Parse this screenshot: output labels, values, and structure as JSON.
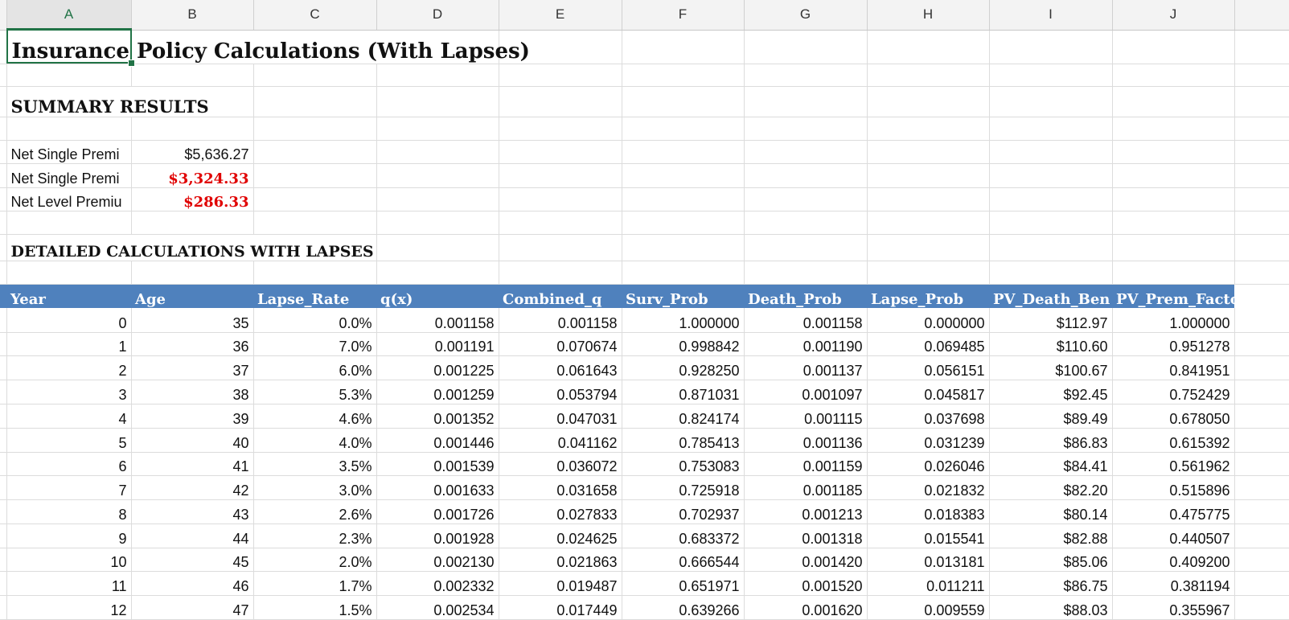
{
  "columns": [
    "A",
    "B",
    "C",
    "D",
    "E",
    "F",
    "G",
    "H",
    "I",
    "J"
  ],
  "selected_column": "A",
  "title": "Insurance Policy Calculations (With Lapses)",
  "summary": {
    "heading": "SUMMARY RESULTS",
    "rows": [
      {
        "label": "Net Single Premi",
        "value": "$5,636.27",
        "highlight": false
      },
      {
        "label": "Net Single Premi",
        "value": "$3,324.33",
        "highlight": true
      },
      {
        "label": "Net Level Premiu",
        "value": "$286.33",
        "highlight": true
      }
    ]
  },
  "details": {
    "heading": "DETAILED CALCULATIONS WITH LAPSES",
    "headers": [
      "Year",
      "Age",
      "Lapse_Rate",
      "q(x)",
      "Combined_q",
      "Surv_Prob",
      "Death_Prob",
      "Lapse_Prob",
      "PV_Death_Ben",
      "PV_Prem_Facto"
    ],
    "rows": [
      [
        "0",
        "35",
        "0.0%",
        "0.001158",
        "0.001158",
        "1.000000",
        "0.001158",
        "0.000000",
        "$112.97",
        "1.000000"
      ],
      [
        "1",
        "36",
        "7.0%",
        "0.001191",
        "0.070674",
        "0.998842",
        "0.001190",
        "0.069485",
        "$110.60",
        "0.951278"
      ],
      [
        "2",
        "37",
        "6.0%",
        "0.001225",
        "0.061643",
        "0.928250",
        "0.001137",
        "0.056151",
        "$100.67",
        "0.841951"
      ],
      [
        "3",
        "38",
        "5.3%",
        "0.001259",
        "0.053794",
        "0.871031",
        "0.001097",
        "0.045817",
        "$92.45",
        "0.752429"
      ],
      [
        "4",
        "39",
        "4.6%",
        "0.001352",
        "0.047031",
        "0.824174",
        "0.001115",
        "0.037698",
        "$89.49",
        "0.678050"
      ],
      [
        "5",
        "40",
        "4.0%",
        "0.001446",
        "0.041162",
        "0.785413",
        "0.001136",
        "0.031239",
        "$86.83",
        "0.615392"
      ],
      [
        "6",
        "41",
        "3.5%",
        "0.001539",
        "0.036072",
        "0.753083",
        "0.001159",
        "0.026046",
        "$84.41",
        "0.561962"
      ],
      [
        "7",
        "42",
        "3.0%",
        "0.001633",
        "0.031658",
        "0.725918",
        "0.001185",
        "0.021832",
        "$82.20",
        "0.515896"
      ],
      [
        "8",
        "43",
        "2.6%",
        "0.001726",
        "0.027833",
        "0.702937",
        "0.001213",
        "0.018383",
        "$80.14",
        "0.475775"
      ],
      [
        "9",
        "44",
        "2.3%",
        "0.001928",
        "0.024625",
        "0.683372",
        "0.001318",
        "0.015541",
        "$82.88",
        "0.440507"
      ],
      [
        "10",
        "45",
        "2.0%",
        "0.002130",
        "0.021863",
        "0.666544",
        "0.001420",
        "0.013181",
        "$85.06",
        "0.409200"
      ],
      [
        "11",
        "46",
        "1.7%",
        "0.002332",
        "0.019487",
        "0.651971",
        "0.001520",
        "0.011211",
        "$86.75",
        "0.381194"
      ],
      [
        "12",
        "47",
        "1.5%",
        "0.002534",
        "0.017449",
        "0.639266",
        "0.001620",
        "0.009559",
        "$88.03",
        "0.355967"
      ]
    ]
  },
  "colors": {
    "header_fill": "#4f81bd",
    "highlight_text": "#e00000",
    "selection": "#217346"
  }
}
